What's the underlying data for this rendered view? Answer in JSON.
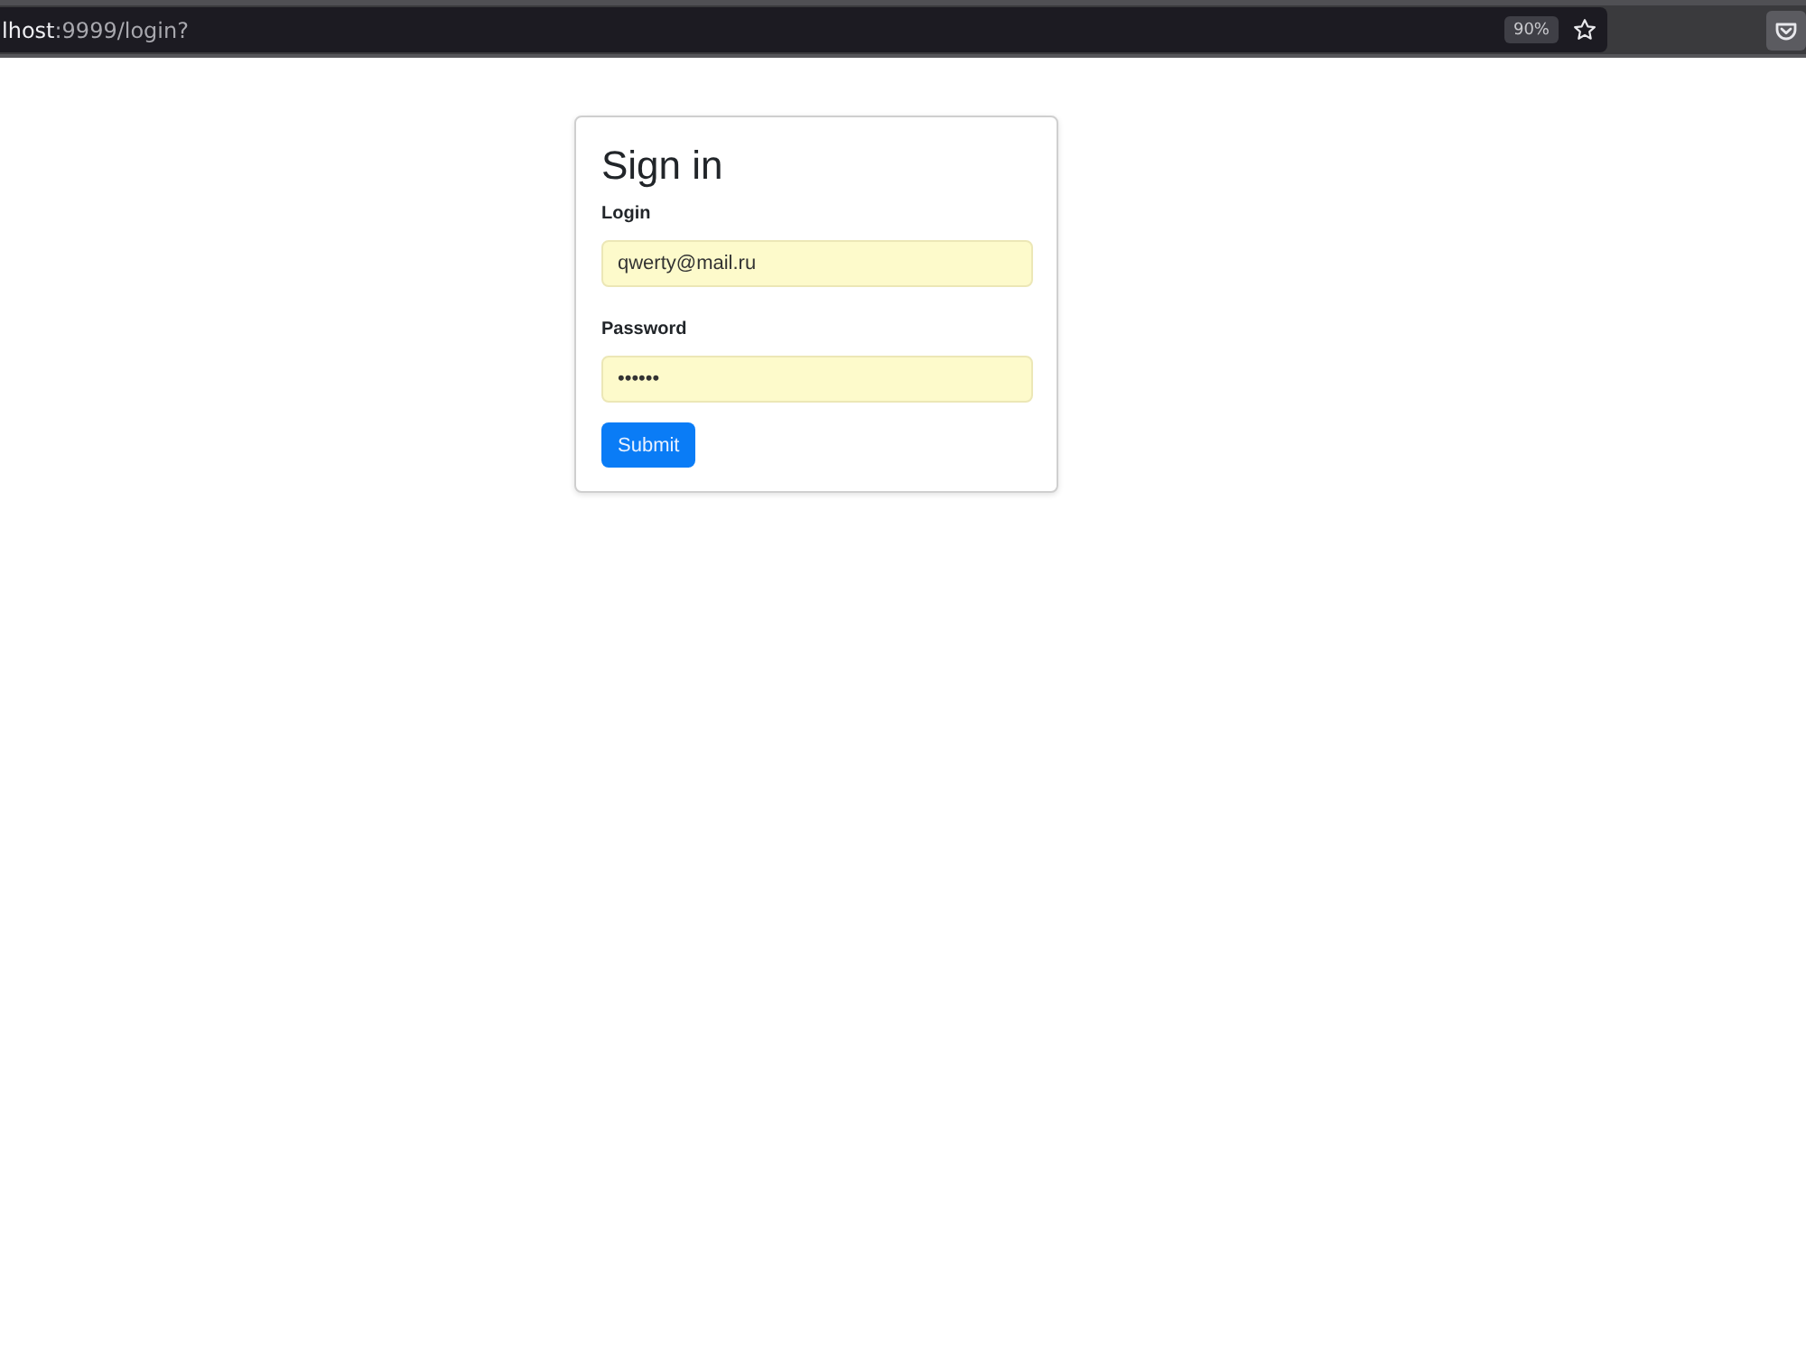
{
  "browser": {
    "url_host": "lhost",
    "url_path": ":9999/login?",
    "zoom": "90%"
  },
  "form": {
    "title": "Sign in",
    "fields": [
      {
        "label": "Login",
        "value": "qwerty@mail.ru",
        "autofilled": true
      },
      {
        "label": "Password",
        "value": "••••••",
        "autofilled": true
      }
    ],
    "submit": "Submit"
  }
}
